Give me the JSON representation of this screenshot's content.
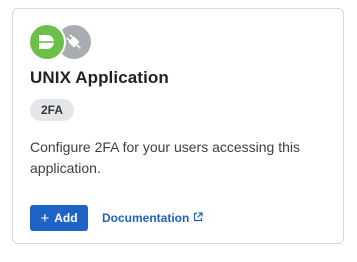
{
  "card": {
    "title": "UNIX Application",
    "badge": "2FA",
    "description": "Configure 2FA for your users accessing this application.",
    "add_button_label": "Add",
    "add_button_icon": "plus-icon",
    "documentation_link_label": "Documentation",
    "documentation_link_icon": "external-link-icon",
    "logos": [
      "duo-logo",
      "plug-icon"
    ]
  },
  "colors": {
    "primary": "#1f63c6",
    "duo_green": "#6cc04a",
    "integration_grey": "#a9adb1",
    "badge_bg": "#e4e6e9"
  }
}
